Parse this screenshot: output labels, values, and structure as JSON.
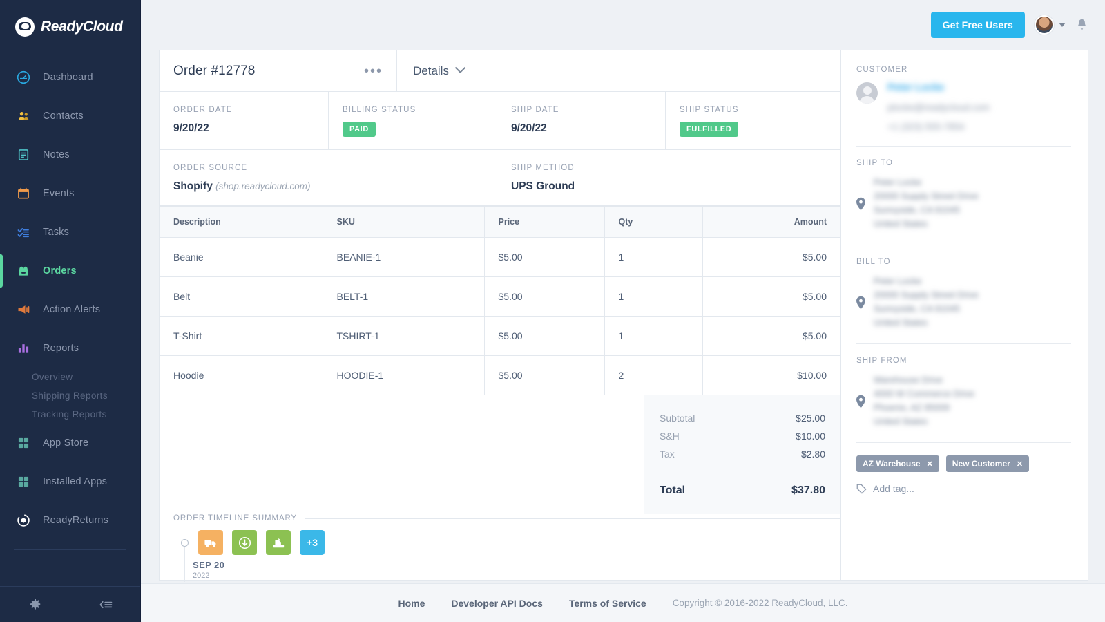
{
  "brand": {
    "name": "ReadyCloud",
    "logo_icon": "readycloud-logo-icon"
  },
  "sidebar": {
    "items": [
      {
        "label": "Dashboard",
        "icon": "dashboard-icon",
        "color": "#29a8e0",
        "active": false
      },
      {
        "label": "Contacts",
        "icon": "contacts-icon",
        "color": "#f0c040",
        "active": false
      },
      {
        "label": "Notes",
        "icon": "notes-icon",
        "color": "#4fc3c7",
        "active": false
      },
      {
        "label": "Events",
        "icon": "calendar-icon",
        "color": "#f09a4a",
        "active": false
      },
      {
        "label": "Tasks",
        "icon": "tasks-icon",
        "color": "#3f7fe0",
        "active": false
      },
      {
        "label": "Orders",
        "icon": "orders-box-icon",
        "color": "#5bd6a0",
        "active": true
      },
      {
        "label": "Action Alerts",
        "icon": "megaphone-icon",
        "color": "#e07a3c",
        "active": false
      },
      {
        "label": "Reports",
        "icon": "bar-chart-icon",
        "color": "#a86fe0",
        "active": false
      }
    ],
    "sub_items": [
      "Overview",
      "Shipping Reports",
      "Tracking Reports"
    ],
    "items_after": [
      {
        "label": "App Store",
        "icon": "grid-icon",
        "color": "#5aa9a0",
        "active": false
      },
      {
        "label": "Installed Apps",
        "icon": "grid-icon",
        "color": "#5aa9a0",
        "active": false
      },
      {
        "label": "ReadyReturns",
        "icon": "readyreturns-icon",
        "color": "#ffffff",
        "active": false
      }
    ],
    "bottom": [
      {
        "icon": "gear-icon",
        "name": "settings-button"
      },
      {
        "icon": "collapse-sidebar-icon",
        "name": "collapse-sidebar-button"
      }
    ],
    "active_color": "#5bd6a0"
  },
  "topbar": {
    "cta_label": "Get Free Users",
    "cta_color": "#29b6ed",
    "avatar_icon": "user-avatar",
    "caret_icon": "chevron-down-icon",
    "bell_icon": "notification-bell-icon"
  },
  "order": {
    "title": "Order #12778",
    "more_icon": "more-options-icon",
    "details_label": "Details",
    "details_caret_icon": "chevron-down-icon",
    "meta": [
      {
        "label": "ORDER DATE",
        "value": "9/20/22",
        "type": "text"
      },
      {
        "label": "BILLING STATUS",
        "value": "PAID",
        "type": "badge",
        "color": "#51c98a"
      },
      {
        "label": "SHIP DATE",
        "value": "9/20/22",
        "type": "text"
      },
      {
        "label": "SHIP STATUS",
        "value": "FULFILLED",
        "type": "badge",
        "color": "#51c98a"
      }
    ],
    "meta2": [
      {
        "label": "ORDER SOURCE",
        "value": "Shopify",
        "sub": "(shop.readycloud.com)"
      },
      {
        "label": "SHIP METHOD",
        "value": "UPS Ground"
      }
    ]
  },
  "items_table": {
    "columns": [
      "Description",
      "SKU",
      "Price",
      "Qty",
      "Amount"
    ],
    "rows": [
      {
        "description": "Beanie",
        "sku": "BEANIE-1",
        "price": "$5.00",
        "qty": "1",
        "amount": "$5.00"
      },
      {
        "description": "Belt",
        "sku": "BELT-1",
        "price": "$5.00",
        "qty": "1",
        "amount": "$5.00"
      },
      {
        "description": "T-Shirt",
        "sku": "TSHIRT-1",
        "price": "$5.00",
        "qty": "1",
        "amount": "$5.00"
      },
      {
        "description": "Hoodie",
        "sku": "HOODIE-1",
        "price": "$5.00",
        "qty": "2",
        "amount": "$10.00"
      }
    ]
  },
  "totals": {
    "rows": [
      {
        "label": "Subtotal",
        "value": "$25.00"
      },
      {
        "label": "S&H",
        "value": "$10.00"
      },
      {
        "label": "Tax",
        "value": "$2.80"
      }
    ],
    "total_label": "Total",
    "total_value": "$37.80"
  },
  "timeline": {
    "title": "ORDER TIMELINE SUMMARY",
    "events": [
      {
        "icon": "shipping-truck-icon",
        "color": "#f5b162",
        "label": ""
      },
      {
        "icon": "download-arrow-icon",
        "color": "#8cc152",
        "label": ""
      },
      {
        "icon": "label-printer-icon",
        "color": "#8cc152",
        "label": ""
      },
      {
        "icon": "more-events-badge",
        "color": "#3bb8e8",
        "label": "+3"
      }
    ],
    "date_primary": "SEP 20",
    "date_secondary": "2022"
  },
  "customer_panel": {
    "customer_label": "CUSTOMER",
    "customer_name": "Peter Locke",
    "customer_email": "plocke@readycloud.com",
    "customer_phone": "+1 (323) 555-7854",
    "ship_to_label": "SHIP TO",
    "ship_to_address": "Peter Locke\n20000 Supply Street Drive\nSunnyside, CA 91045\nUnited States",
    "bill_to_label": "BILL TO",
    "bill_to_address": "Peter Locke\n20000 Supply Street Drive\nSunnyside, CA 91045\nUnited States",
    "ship_from_label": "SHIP FROM",
    "ship_from_address": "Warehouse Drive\n4000 W Commerce Drive\nPhoenix, AZ 85009\nUnited States",
    "pin_icon": "location-pin-icon",
    "tags": [
      {
        "label": "AZ Warehouse",
        "remove_icon": "close-icon"
      },
      {
        "label": "New Customer",
        "remove_icon": "close-icon"
      }
    ],
    "add_tag_label": "Add tag...",
    "add_tag_icon": "tag-icon"
  },
  "footer": {
    "links": [
      "Home",
      "Developer API Docs",
      "Terms of Service"
    ],
    "copyright": "Copyright © 2016-2022 ReadyCloud, LLC."
  }
}
